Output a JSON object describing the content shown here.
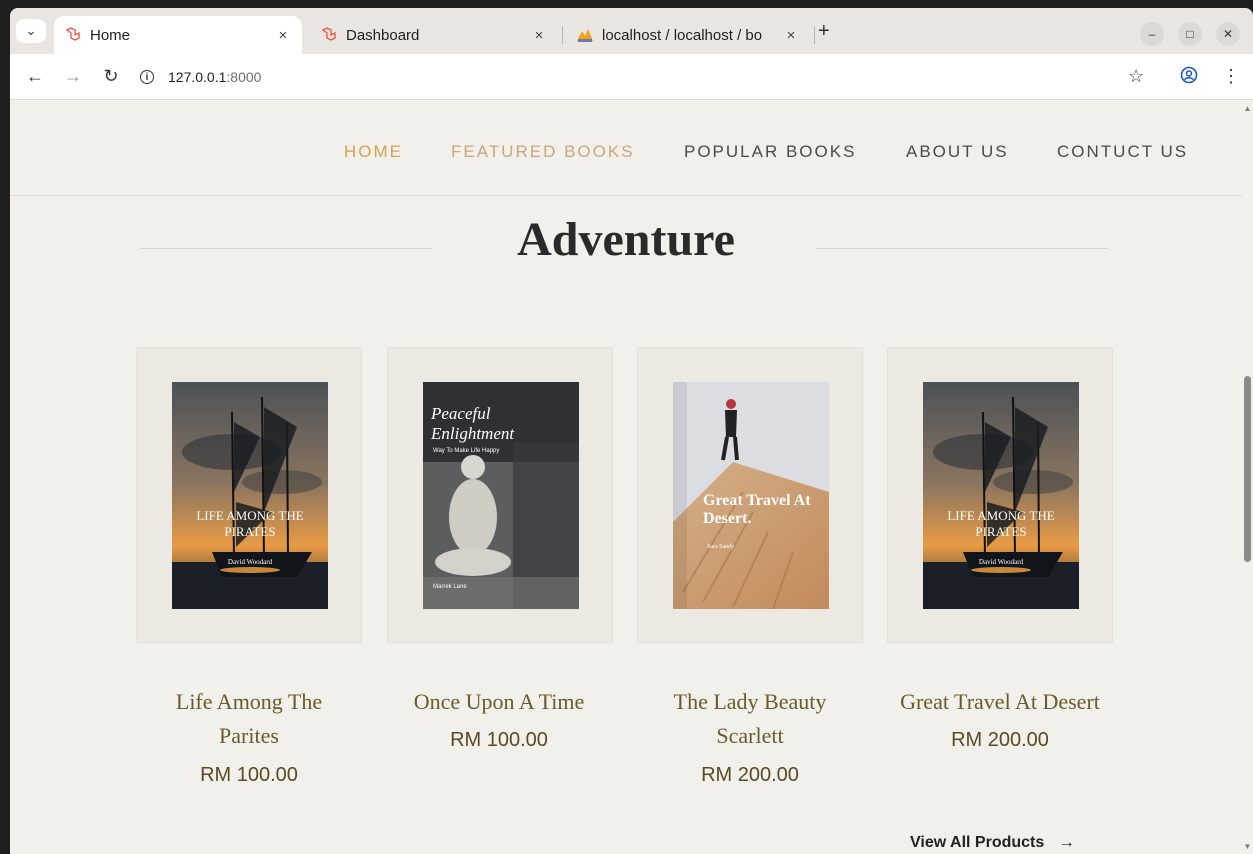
{
  "browser": {
    "tabs": [
      {
        "title": "Home",
        "active": true
      },
      {
        "title": "Dashboard",
        "active": false
      },
      {
        "title": "localhost / localhost / bo",
        "active": false
      }
    ],
    "close_glyph": "×",
    "new_tab_glyph": "+",
    "url_host": "127.0.0.1",
    "url_port": ":8000"
  },
  "nav": {
    "items": [
      "HOME",
      "FEATURED BOOKS",
      "POPULAR BOOKS",
      "ABOUT US",
      "CONTUCT US"
    ]
  },
  "section": {
    "title": "Adventure"
  },
  "products": [
    {
      "name": "Life Among The Parites",
      "price": "RM 100.00",
      "cover_title": "LIFE AMONG THE PIRATES",
      "cover_author": "David Woodard",
      "cover_style": "ship"
    },
    {
      "name": "Once Upon A Time",
      "price": "RM 100.00",
      "cover_title": "Peaceful Enlightment",
      "cover_subtitle": "Way To Make Life Happy",
      "cover_author": "Marrek Lane",
      "cover_style": "buddha"
    },
    {
      "name": "The Lady Beauty Scarlett",
      "price": "RM 200.00",
      "cover_title": "Great Travel At Desert.",
      "cover_author": "Sara Sandy",
      "cover_style": "desert"
    },
    {
      "name": "Great Travel At Desert",
      "price": "RM 200.00",
      "cover_title": "LIFE AMONG THE PIRATES",
      "cover_author": "David Woodard",
      "cover_style": "ship"
    }
  ],
  "footer_link": {
    "label": "View All Products",
    "arrow": "→"
  },
  "colors": {
    "page_bg": "#f2f0eb",
    "nav_active": "#d6a153",
    "title_text": "#2a2a2a",
    "product_name": "#6b5a2a",
    "price": "#5a4a24"
  }
}
